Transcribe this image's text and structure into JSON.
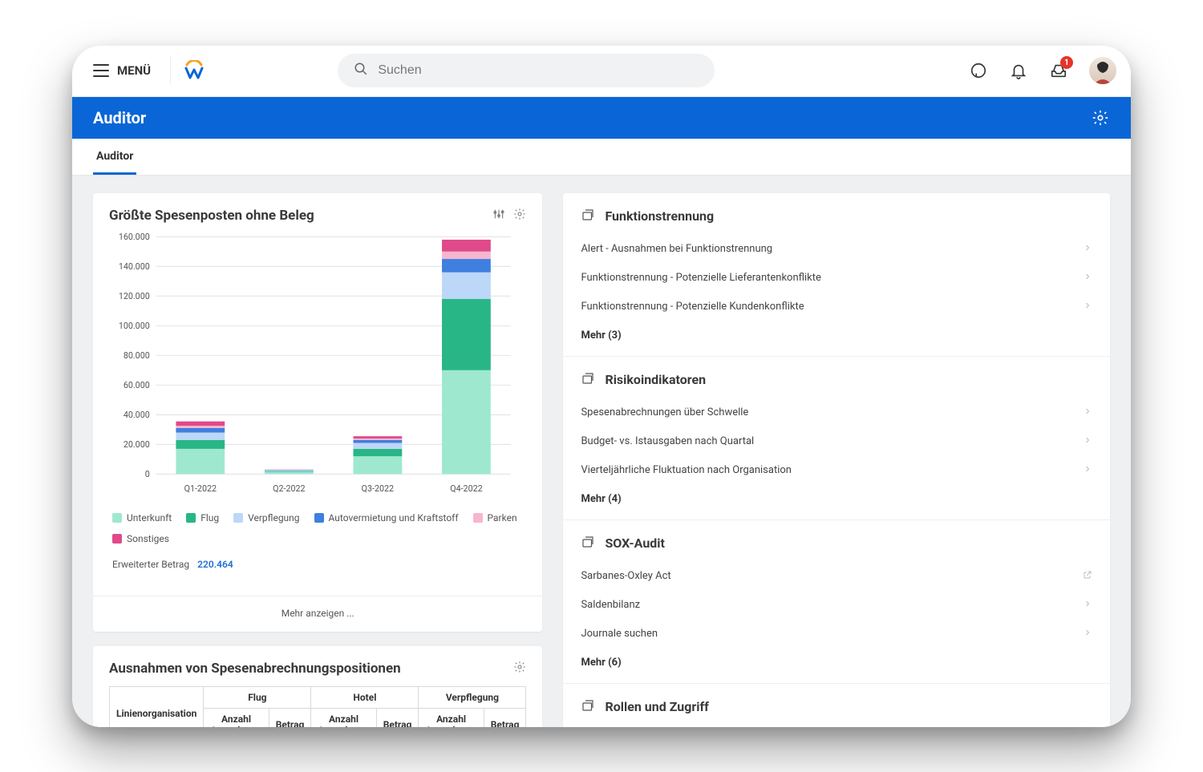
{
  "colors": {
    "accent": "#0a66d6",
    "series": {
      "unterkunft": "#9fe8d0",
      "flug": "#29b687",
      "verpflegung": "#bcd7f7",
      "auto": "#3f7fe0",
      "parken": "#f7b6cf",
      "sonstiges": "#e04a8a"
    }
  },
  "topbar": {
    "menu_label": "MENÜ",
    "search_placeholder": "Suchen",
    "inbox_badge": "1"
  },
  "header": {
    "title": "Auditor"
  },
  "tabs": [
    {
      "label": "Auditor"
    }
  ],
  "chart_card": {
    "title": "Größte Spesenposten ohne Beleg",
    "extended_label": "Erweiterter Betrag",
    "extended_value": "220.464",
    "show_more": "Mehr anzeigen ..."
  },
  "chart_data": {
    "type": "bar",
    "stacked": true,
    "title": "Größte Spesenposten ohne Beleg",
    "xlabel": "",
    "ylabel": "",
    "ylim": [
      0,
      160000
    ],
    "yticks": [
      0,
      20000,
      40000,
      60000,
      80000,
      100000,
      120000,
      140000,
      160000
    ],
    "ytick_labels": [
      "0",
      "20.000",
      "40.000",
      "60.000",
      "80.000",
      "100.000",
      "120.000",
      "140.000",
      "160.000"
    ],
    "categories": [
      "Q1-2022",
      "Q2-2022",
      "Q3-2022",
      "Q4-2022"
    ],
    "series": [
      {
        "name": "Unterkunft",
        "color": "#9fe8d0",
        "values": [
          17000,
          1500,
          12000,
          70000
        ]
      },
      {
        "name": "Flug",
        "color": "#29b687",
        "values": [
          6000,
          500,
          5000,
          48000
        ]
      },
      {
        "name": "Verpflegung",
        "color": "#bcd7f7",
        "values": [
          5000,
          500,
          4000,
          18000
        ]
      },
      {
        "name": "Autovermietung und Kraftstoff",
        "color": "#3f7fe0",
        "values": [
          3000,
          300,
          2000,
          9000
        ]
      },
      {
        "name": "Parken",
        "color": "#f7b6cf",
        "values": [
          1500,
          100,
          1000,
          5000
        ]
      },
      {
        "name": "Sonstiges",
        "color": "#e04a8a",
        "values": [
          3000,
          100,
          1500,
          8000
        ]
      }
    ]
  },
  "exceptions_card": {
    "title": "Ausnahmen von Spesenabrechnungspositionen",
    "row_header": "Linienorganisation",
    "groups": [
      {
        "label": "Flug",
        "cols": [
          "Anzahl Ausnahmen",
          "Betrag"
        ]
      },
      {
        "label": "Hotel",
        "cols": [
          "Anzahl Ausnahmen",
          "Betrag"
        ]
      },
      {
        "label": "Verpflegung",
        "cols": [
          "Anzahl Ausnahmen",
          "Betrag"
        ]
      }
    ]
  },
  "right": {
    "sections": [
      {
        "title": "Funktionstrennung",
        "links": [
          {
            "label": "Alert - Ausnahmen bei Funktionstrennung",
            "kind": "nav"
          },
          {
            "label": "Funktionstrennung - Potenzielle Lieferantenkonflikte",
            "kind": "nav"
          },
          {
            "label": "Funktionstrennung - Potenzielle Kundenkonflikte",
            "kind": "nav"
          }
        ],
        "more": "Mehr (3)"
      },
      {
        "title": "Risikoindikatoren",
        "links": [
          {
            "label": "Spesenabrechnungen über Schwelle",
            "kind": "nav"
          },
          {
            "label": "Budget- vs. Istausgaben nach Quartal",
            "kind": "nav"
          },
          {
            "label": "Vierteljährliche Fluktuation nach Organisation",
            "kind": "nav"
          }
        ],
        "more": "Mehr (4)"
      },
      {
        "title": "SOX-Audit",
        "links": [
          {
            "label": "Sarbanes-Oxley Act",
            "kind": "ext"
          },
          {
            "label": "Saldenbilanz",
            "kind": "nav"
          },
          {
            "label": "Journale suchen",
            "kind": "nav"
          }
        ],
        "more": "Mehr (6)"
      },
      {
        "title": "Rollen und Zugriff",
        "links": [],
        "more": null
      }
    ]
  }
}
